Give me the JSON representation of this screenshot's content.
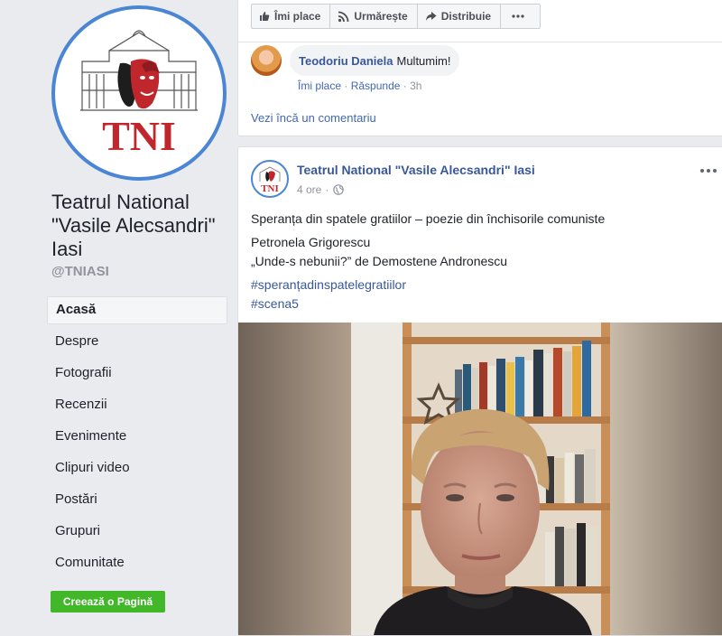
{
  "page": {
    "name": "Teatrul National \"Vasile Alecsandri\" Iasi",
    "handle": "@TNIASI",
    "logo_text": "TNI",
    "brand_red": "#c0272d",
    "brand_blue": "#4a86d4"
  },
  "nav": {
    "items": [
      "Acasă",
      "Despre",
      "Fotografii",
      "Recenzii",
      "Evenimente",
      "Clipuri video",
      "Postări",
      "Grupuri",
      "Comunitate"
    ],
    "active": "Acasă",
    "create_page": "Creează o Pagină"
  },
  "previous_post": {
    "actions": {
      "like": "Îmi place",
      "follow": "Urmărește",
      "share": "Distribuie",
      "more_icon": "ellipsis-icon"
    },
    "comment": {
      "author": "Teodoriu Daniela",
      "text": "Multumim!",
      "like": "Îmi place",
      "reply": "Răspunde",
      "sep": "·",
      "time": "3h"
    },
    "more_comments": "Vezi încă un comentariu"
  },
  "post": {
    "author": "Teatrul National \"Vasile Alecsandri\" Iasi",
    "time": "4 ore",
    "sep": "·",
    "privacy_icon": "globe-icon",
    "menu_icon": "ellipsis-icon",
    "lines": [
      "Speranța din spatele gratiilor – poezie din închisorile comuniste",
      "Petronela Grigorescu",
      "„Unde-s nebunii?” de Demostene Andronescu"
    ],
    "hashtags": [
      "#speranțadinspatelegratiilor",
      "#scena5"
    ]
  }
}
